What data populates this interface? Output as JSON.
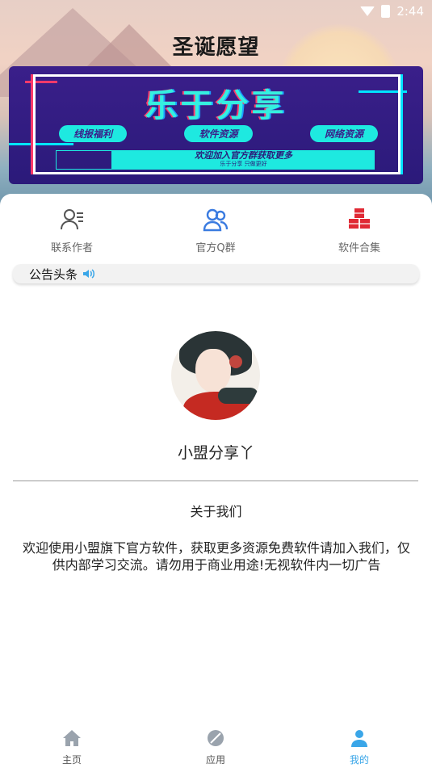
{
  "status_bar": {
    "time": "2:44"
  },
  "header": {
    "title": "圣诞愿望"
  },
  "banner": {
    "headline": "乐于分享",
    "pills": [
      "线报福利",
      "软件资源",
      "网络资源"
    ],
    "cta": "欢迎加入官方群获取更多",
    "cta_sub": "乐于分享 只做更好"
  },
  "quick_actions": [
    {
      "label": "联系作者",
      "icon": "contact-author-icon",
      "color": "#555555"
    },
    {
      "label": "官方Q群",
      "icon": "group-users-icon",
      "color": "#3a7be0"
    },
    {
      "label": "软件合集",
      "icon": "cubes-icon",
      "color": "#e02a35"
    }
  ],
  "notice": {
    "title": "公告头条",
    "icon": "speaker-icon",
    "icon_color": "#3aa6e8"
  },
  "profile": {
    "name": "小盟分享丫"
  },
  "about": {
    "title": "关于我们",
    "text": "欢迎使用小盟旗下官方软件，获取更多资源免费软件请加入我们，仅供内部学习交流。请勿用于商业用途!无视软件内一切广告"
  },
  "tabbar": {
    "tabs": [
      {
        "label": "主页",
        "icon": "home-icon",
        "active": false
      },
      {
        "label": "应用",
        "icon": "apps-icon",
        "active": false
      },
      {
        "label": "我的",
        "icon": "profile-icon",
        "active": true
      }
    ],
    "active_color": "#3aa6e8",
    "inactive_color": "#999999"
  }
}
